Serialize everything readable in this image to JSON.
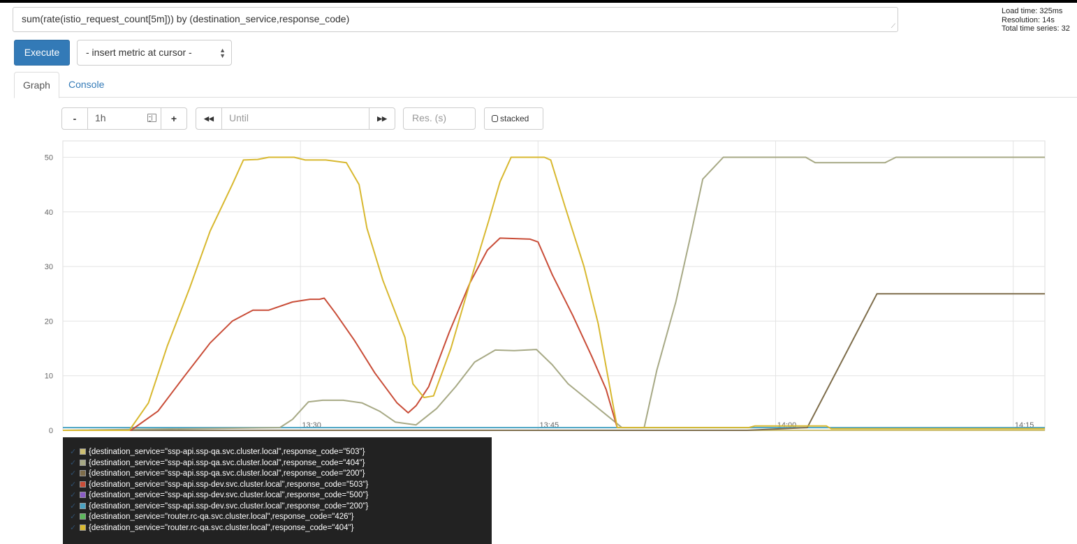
{
  "query": {
    "expression": "sum(rate(istio_request_count[5m])) by (destination_service,response_code)"
  },
  "stats": {
    "load_time": "Load time: 325ms",
    "resolution": "Resolution: 14s",
    "total_series": "Total time series: 32"
  },
  "toolbar": {
    "execute_label": "Execute",
    "metric_select": "- insert metric at cursor -"
  },
  "tabs": [
    {
      "label": "Graph",
      "active": true
    },
    {
      "label": "Console",
      "active": false
    }
  ],
  "graph_controls": {
    "minus": "-",
    "plus": "+",
    "range": "1h",
    "back": "◀◀",
    "until_placeholder": "Until",
    "forward": "▶▶",
    "res_placeholder": "Res. (s)",
    "stacked_label": "stacked"
  },
  "colors": {
    "accent": "#337ab7",
    "legend_bg": "#222222"
  },
  "chart_data": {
    "type": "line",
    "title": "",
    "xlabel": "",
    "ylabel": "",
    "ylim": [
      0,
      53
    ],
    "xlim": [
      1275,
      1337
    ],
    "x_ticks": [
      {
        "value": 1290,
        "label": "13:30"
      },
      {
        "value": 1305,
        "label": "13:45"
      },
      {
        "value": 1320,
        "label": "14:00"
      },
      {
        "value": 1335,
        "label": "14:15"
      }
    ],
    "y_ticks": [
      0,
      10,
      20,
      30,
      40,
      50
    ],
    "grid": true,
    "series": [
      {
        "name": "{destination_service=\"ssp-api.ssp-qa.svc.cluster.local\",response_code=\"503\"}",
        "color": "#cdbf72",
        "x": [
          1275,
          1339
        ],
        "y": [
          0,
          0
        ]
      },
      {
        "name": "{destination_service=\"ssp-api.ssp-qa.svc.cluster.local\",response_code=\"404\"}",
        "color": "#a7a985",
        "x": [
          1275,
          1288.7,
          1289.5,
          1290.5,
          1291.4,
          1292.7,
          1293.9,
          1295.0,
          1296.0,
          1297.3,
          1298.6,
          1299.8,
          1301.0,
          1302.3,
          1303.5,
          1304.9,
          1305.9,
          1306.9,
          1310.3,
          1311.7,
          1312.5,
          1313.7,
          1314.7,
          1315.4,
          1316.7,
          1317.5,
          1321.9,
          1322.5,
          1326.9,
          1327.6,
          1331.5,
          1337
        ],
        "y": [
          0,
          0.5,
          2.0,
          5.2,
          5.5,
          5.5,
          5.0,
          3.5,
          1.5,
          1.0,
          4.0,
          8.0,
          12.5,
          14.7,
          14.6,
          14.8,
          12.0,
          8.5,
          0.5,
          0.5,
          11.0,
          23.5,
          36.5,
          46.0,
          50.0,
          50.0,
          50.0,
          49.0,
          49.0,
          50.0,
          50.0,
          50.0
        ]
      },
      {
        "name": "{destination_service=\"ssp-api.ssp-qa.svc.cluster.local\",response_code=\"200\"}",
        "color": "#7e6d4b",
        "x": [
          1275,
          1318.2,
          1322.0,
          1326.4,
          1337
        ],
        "y": [
          0,
          0,
          0.5,
          25.0,
          25.0
        ]
      },
      {
        "name": "{destination_service=\"ssp-api.ssp-dev.svc.cluster.local\",response_code=\"503\"}",
        "color": "#c94d38",
        "x": [
          1275,
          1279.3,
          1281.0,
          1282.7,
          1284.3,
          1285.7,
          1287.0,
          1288.0,
          1289.5,
          1290.6,
          1291.2,
          1291.5,
          1292.2,
          1293.4,
          1294.7,
          1296.1,
          1296.8,
          1297.3,
          1298.1,
          1299.4,
          1300.7,
          1301.8,
          1302.6,
          1304.5,
          1305.0,
          1305.9,
          1307.2,
          1308.4,
          1309.3,
          1310.0
        ],
        "y": [
          0,
          0,
          3.5,
          10.0,
          16.0,
          20.0,
          22.0,
          22.0,
          23.5,
          24.0,
          24.0,
          24.2,
          21.5,
          16.5,
          10.5,
          5.0,
          3.2,
          4.5,
          8.0,
          18.0,
          27.0,
          33.0,
          35.2,
          35.0,
          34.5,
          28.5,
          21.0,
          13.5,
          7.5,
          0.5
        ]
      },
      {
        "name": "{destination_service=\"ssp-api.ssp-dev.svc.cluster.local\",response_code=\"500\"}",
        "color": "#8a5cc5",
        "x": [
          1275,
          1339
        ],
        "y": [
          0,
          0
        ]
      },
      {
        "name": "{destination_service=\"ssp-api.ssp-dev.svc.cluster.local\",response_code=\"200\"}",
        "color": "#4aa3c3",
        "x": [
          1275,
          1339
        ],
        "y": [
          0.5,
          0.5
        ]
      },
      {
        "name": "{destination_service=\"router.rc-qa.svc.cluster.local\",response_code=\"426\"}",
        "color": "#5cb85c",
        "x": [
          1275,
          1339
        ],
        "y": [
          0,
          0
        ]
      },
      {
        "name": "{destination_service=\"router.rc-qa.svc.cluster.local\",response_code=\"404\"}",
        "color": "#d8b82f",
        "x": [
          1275,
          1279.2,
          1280.4,
          1281.6,
          1283.0,
          1284.3,
          1285.7,
          1286.4,
          1287.3,
          1288.0,
          1289.6,
          1290.3,
          1290.8,
          1291.6,
          1292.9,
          1293.7,
          1294.2,
          1295.2,
          1296.6,
          1297.1,
          1297.8,
          1298.4,
          1299.5,
          1300.7,
          1301.9,
          1302.6,
          1303.3,
          1304.3,
          1305.4,
          1305.8,
          1306.7,
          1307.9,
          1308.8,
          1310.0,
          1318.3,
          1318.7,
          1323.2,
          1323.5,
          1337
        ],
        "y": [
          0,
          0,
          5.0,
          15.5,
          26.0,
          36.5,
          45.0,
          49.5,
          49.6,
          50.0,
          50.0,
          49.5,
          49.5,
          49.5,
          49.0,
          45.0,
          37.0,
          27.5,
          17.0,
          8.5,
          6.0,
          6.3,
          15.0,
          27.0,
          38.5,
          45.5,
          50.0,
          50.0,
          50.0,
          49.5,
          41.0,
          30.0,
          19.5,
          0.5,
          0.5,
          0.8,
          0.8,
          0.3,
          0.3
        ]
      }
    ]
  }
}
